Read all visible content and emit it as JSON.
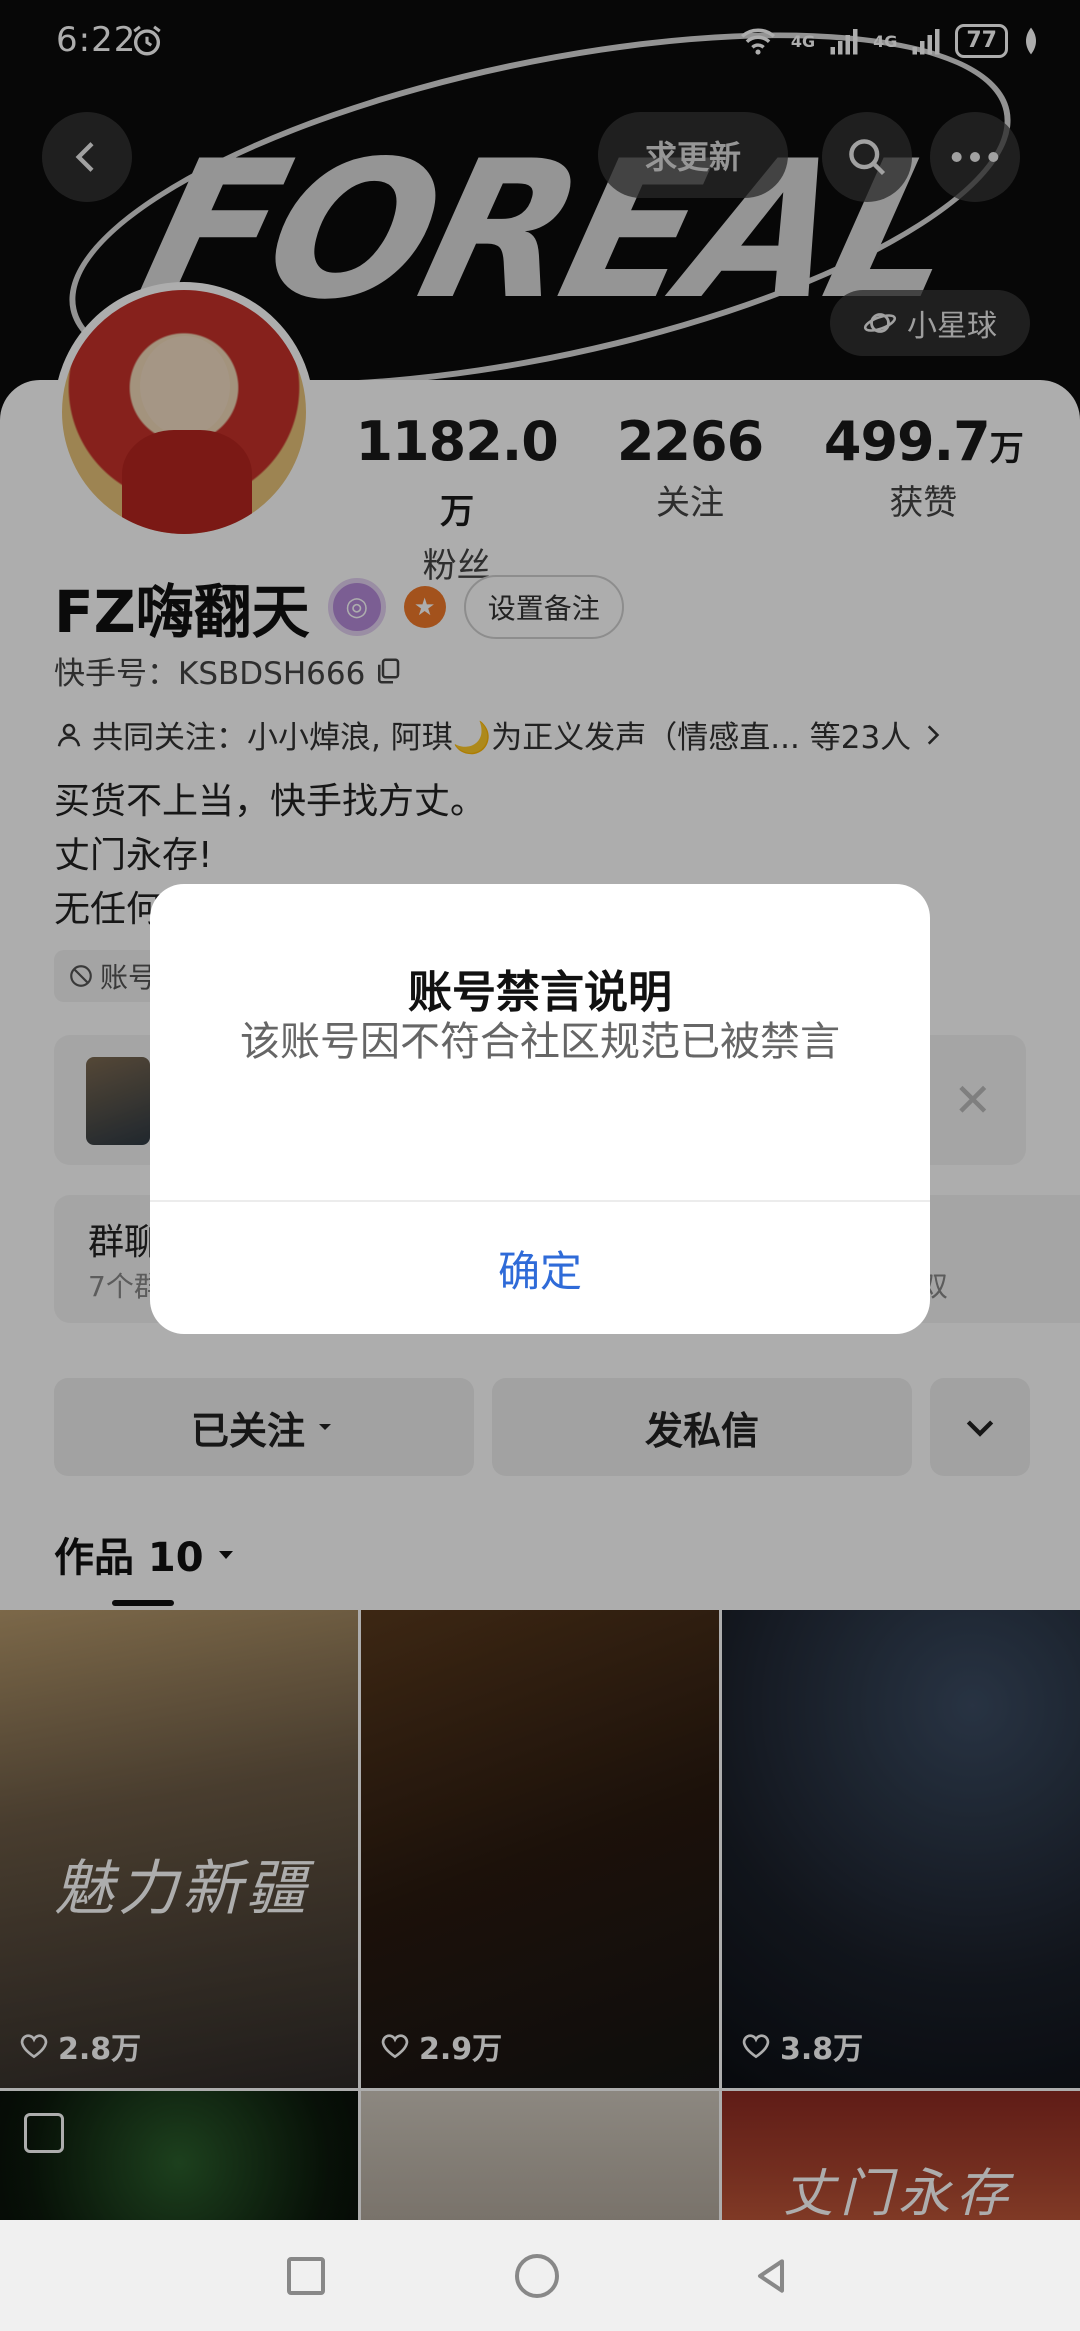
{
  "status_bar": {
    "time": "6:22",
    "network_1": "4G",
    "network_2": "4G",
    "battery": "77"
  },
  "header": {
    "banner_logo_text": "FOREAL",
    "update_button": "求更新",
    "planet_button": "小星球"
  },
  "profile": {
    "stats": [
      {
        "value": "1182.0",
        "unit": "万",
        "label": "粉丝"
      },
      {
        "value": "2266",
        "unit": "",
        "label": "关注"
      },
      {
        "value": "499.7",
        "unit": "万",
        "label": "获赞"
      }
    ],
    "name": "FZ嗨翻天",
    "remark_button": "设置备注",
    "kuaishou_id": "快手号：KSBDSH666",
    "mutual_follow": "共同关注：小小焯浪, 阿琪🌙为正义发声（情感直... 等23人",
    "bio_lines": [
      "买货不上当，快手找方丈。",
      "丈门永存!",
      "无任何"
    ],
    "ban_tag": "账号"
  },
  "group": {
    "title": "群聊",
    "subtitle": "7个群",
    "subtitle_tail": "双"
  },
  "actions": {
    "follow": "已关注",
    "message": "发私信"
  },
  "works": {
    "tab_label": "作品 10"
  },
  "grid": [
    {
      "overlay": "魅力新疆",
      "likes": "2.8万"
    },
    {
      "overlay": "",
      "likes": "2.9万"
    },
    {
      "overlay": "",
      "likes": "3.8万"
    },
    {
      "overlay": "",
      "likes": ""
    },
    {
      "overlay": "",
      "likes": ""
    },
    {
      "overlay": "丈门永存",
      "likes": ""
    }
  ],
  "dialog": {
    "title": "账号禁言说明",
    "message": "该账号因不符合社区规范已被禁言",
    "confirm": "确定"
  },
  "colors": {
    "accent_blue": "#2f6bd8",
    "badge_orange": "#f07a2a",
    "badge_purple": "#b58bd9"
  }
}
